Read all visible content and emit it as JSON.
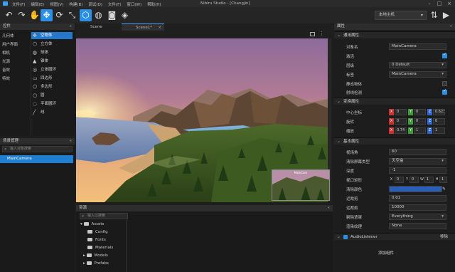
{
  "app": {
    "title": "Nibiru Studio - [Changjin]",
    "menu": [
      "文件(F)",
      "编辑(E)",
      "视图(V)",
      "构建(B)",
      "调试(D)",
      "文件(F)",
      "窗口(W)",
      "帮助(H)"
    ],
    "host_select": "本地主机"
  },
  "hierarchy": {
    "title": "控件",
    "categories": [
      "几何体",
      "用户界面",
      "相机",
      "光源",
      "音效",
      "特效"
    ],
    "objects": [
      "空物体",
      "立方体",
      "球体",
      "锥体",
      "立体圆环",
      "四边形",
      "多边形",
      "圆",
      "平面圆环",
      "线"
    ],
    "selected_index": 0
  },
  "scene_tree": {
    "title": "场景管理",
    "search_placeholder": "输入对象搜索",
    "item": "MainCamera"
  },
  "tabs": [
    {
      "label": "Scene"
    },
    {
      "label": "Scene1*"
    }
  ],
  "preview": {
    "label": "MainCam"
  },
  "assets": {
    "title": "资源",
    "search_placeholder": "输入以搜索",
    "root": "Assets",
    "folders": [
      "Config",
      "Fonts",
      "Materials",
      "Models",
      "Prefabs"
    ]
  },
  "properties": {
    "title": "属性",
    "general": {
      "title": "通用属性",
      "name_label": "对象名",
      "name_value": "MainCamera",
      "active_label": "激活",
      "layer_label": "层级",
      "layer_value": "0 Default",
      "tag_label": "标签",
      "tag_value": "MainCamera",
      "static_label": "静态物体",
      "shadow_label": "射线检测"
    },
    "transform": {
      "title": "变换属性",
      "position_label": "中心坐标",
      "position": [
        "0",
        "0",
        "0.623"
      ],
      "rotation_label": "旋转",
      "rotation": [
        "0",
        "0",
        "0"
      ],
      "scale_label": "缩放",
      "scale": [
        "0.74",
        "1",
        "1"
      ]
    },
    "camera": {
      "title": "基本属性",
      "fov_label": "视场角",
      "fov_value": "60",
      "clear_label": "清除屏幕类型",
      "clear_value": "天空盒",
      "depth_label": "深度",
      "depth_value": "-1",
      "viewport_label": "视口矩形",
      "viewport": [
        "0",
        "0",
        "1",
        "1"
      ],
      "bg_label": "清除颜色",
      "near_label": "近裁剪",
      "near_value": "0.01",
      "far_label": "远裁剪",
      "far_value": "10000",
      "cull_label": "剔除遮罩",
      "cull_value": "Everything",
      "target_label": "渲染纹理",
      "target_value": "None"
    },
    "audio": {
      "title": "AudioListener",
      "remove": "移除"
    },
    "add_component": "添加组件"
  },
  "colors": {
    "accent": "#2c8fe6",
    "selection": "#2577c9"
  }
}
